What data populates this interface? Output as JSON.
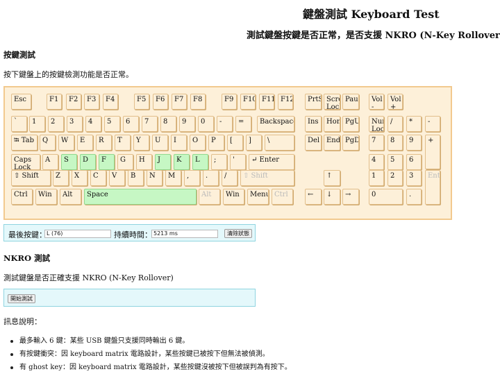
{
  "header": {
    "title": "鍵盤測試 Keyboard Test",
    "subtitle": "測試鍵盤按鍵是否正常，是否支援 NKRO (N-Key Rollover)"
  },
  "key_test": {
    "heading": "按鍵測試",
    "description": "按下鍵盤上的按鍵檢測功能是否正常。"
  },
  "keyboard": {
    "keys": [
      {
        "label": "Esc",
        "state": "normal"
      },
      {
        "label": "F1",
        "state": "normal"
      },
      {
        "label": "F2",
        "state": "normal"
      },
      {
        "label": "F3",
        "state": "normal"
      },
      {
        "label": "F4",
        "state": "normal"
      },
      {
        "label": "F5",
        "state": "normal"
      },
      {
        "label": "F6",
        "state": "normal"
      },
      {
        "label": "F7",
        "state": "normal"
      },
      {
        "label": "F8",
        "state": "normal"
      },
      {
        "label": "F9",
        "state": "normal"
      },
      {
        "label": "F10",
        "state": "normal"
      },
      {
        "label": "F11",
        "state": "normal"
      },
      {
        "label": "F12",
        "state": "normal"
      },
      {
        "label": "PrtSc",
        "state": "normal"
      },
      {
        "label": "Scroll Lock",
        "state": "normal"
      },
      {
        "label": "Pause",
        "state": "normal"
      },
      {
        "label": "Vol -",
        "state": "normal"
      },
      {
        "label": "Vol +",
        "state": "normal"
      },
      {
        "label": "`",
        "state": "normal"
      },
      {
        "label": "1",
        "state": "normal"
      },
      {
        "label": "2",
        "state": "normal"
      },
      {
        "label": "3",
        "state": "normal"
      },
      {
        "label": "4",
        "state": "normal"
      },
      {
        "label": "5",
        "state": "normal"
      },
      {
        "label": "6",
        "state": "normal"
      },
      {
        "label": "7",
        "state": "normal"
      },
      {
        "label": "8",
        "state": "normal"
      },
      {
        "label": "9",
        "state": "normal"
      },
      {
        "label": "0",
        "state": "normal"
      },
      {
        "label": "-",
        "state": "normal"
      },
      {
        "label": "=",
        "state": "normal"
      },
      {
        "label": "Backspace",
        "state": "normal"
      },
      {
        "label": "Ins",
        "state": "normal"
      },
      {
        "label": "Home",
        "state": "normal"
      },
      {
        "label": "PgUp",
        "state": "normal"
      },
      {
        "label": "Num Lock",
        "state": "normal"
      },
      {
        "label": "/",
        "state": "normal"
      },
      {
        "label": "*",
        "state": "normal"
      },
      {
        "label": "-",
        "state": "normal"
      },
      {
        "label": "⭾ Tab",
        "state": "normal"
      },
      {
        "label": "Q",
        "state": "normal"
      },
      {
        "label": "W",
        "state": "normal"
      },
      {
        "label": "E",
        "state": "normal"
      },
      {
        "label": "R",
        "state": "normal"
      },
      {
        "label": "T",
        "state": "normal"
      },
      {
        "label": "Y",
        "state": "normal"
      },
      {
        "label": "U",
        "state": "normal"
      },
      {
        "label": "I",
        "state": "normal"
      },
      {
        "label": "O",
        "state": "normal"
      },
      {
        "label": "P",
        "state": "normal"
      },
      {
        "label": "[",
        "state": "normal"
      },
      {
        "label": "]",
        "state": "normal"
      },
      {
        "label": "\\",
        "state": "normal"
      },
      {
        "label": "Del",
        "state": "normal"
      },
      {
        "label": "End",
        "state": "normal"
      },
      {
        "label": "PgDn",
        "state": "normal"
      },
      {
        "label": "7",
        "state": "normal"
      },
      {
        "label": "8",
        "state": "normal"
      },
      {
        "label": "9",
        "state": "normal"
      },
      {
        "label": "+",
        "state": "normal"
      },
      {
        "label": "Caps Lock",
        "state": "normal"
      },
      {
        "label": "A",
        "state": "normal"
      },
      {
        "label": "S",
        "state": "pressed"
      },
      {
        "label": "D",
        "state": "pressed"
      },
      {
        "label": "F",
        "state": "pressed"
      },
      {
        "label": "G",
        "state": "normal"
      },
      {
        "label": "H",
        "state": "normal"
      },
      {
        "label": "J",
        "state": "pressed"
      },
      {
        "label": "K",
        "state": "pressed"
      },
      {
        "label": "L",
        "state": "pressed"
      },
      {
        "label": ";",
        "state": "normal"
      },
      {
        "label": "'",
        "state": "normal"
      },
      {
        "label": "↵ Enter",
        "state": "normal"
      },
      {
        "label": "4",
        "state": "normal"
      },
      {
        "label": "5",
        "state": "normal"
      },
      {
        "label": "6",
        "state": "normal"
      },
      {
        "label": "⇧ Shift",
        "state": "normal"
      },
      {
        "label": "Z",
        "state": "normal"
      },
      {
        "label": "X",
        "state": "normal"
      },
      {
        "label": "C",
        "state": "normal"
      },
      {
        "label": "V",
        "state": "normal"
      },
      {
        "label": "B",
        "state": "normal"
      },
      {
        "label": "N",
        "state": "normal"
      },
      {
        "label": "M",
        "state": "normal"
      },
      {
        "label": ",",
        "state": "normal"
      },
      {
        "label": ".",
        "state": "normal"
      },
      {
        "label": "/",
        "state": "normal"
      },
      {
        "label": "⇧ Shift",
        "state": "disabled"
      },
      {
        "label": "↑",
        "state": "normal"
      },
      {
        "label": "1",
        "state": "normal"
      },
      {
        "label": "2",
        "state": "normal"
      },
      {
        "label": "3",
        "state": "normal"
      },
      {
        "label": "Enter",
        "state": "disabled"
      },
      {
        "label": "Ctrl",
        "state": "normal"
      },
      {
        "label": "Win",
        "state": "normal"
      },
      {
        "label": "Alt",
        "state": "normal"
      },
      {
        "label": "Space",
        "state": "pressed"
      },
      {
        "label": "Alt",
        "state": "disabled"
      },
      {
        "label": "Win",
        "state": "normal"
      },
      {
        "label": "Menu",
        "state": "normal"
      },
      {
        "label": "Ctrl",
        "state": "disabled"
      },
      {
        "label": "←",
        "state": "normal"
      },
      {
        "label": "↓",
        "state": "normal"
      },
      {
        "label": "→",
        "state": "normal"
      },
      {
        "label": "0",
        "state": "normal"
      },
      {
        "label": ".",
        "state": "normal"
      }
    ]
  },
  "status": {
    "last_key_label": "最後按鍵：",
    "last_key_value": "L (76)",
    "duration_label": "持續時間：",
    "duration_value": "5213 ms",
    "clear_button": "清除狀態"
  },
  "nkro": {
    "heading": "NKRO 測試",
    "description": "測試鍵盤是否正確支援 NKRO (N-Key Rollover)",
    "start_button": "開始測試"
  },
  "info": {
    "heading": "訊息說明：",
    "items": [
      "最多輸入 6 鍵：某些 USB 鍵盤只支援同時輸出 6 鍵。",
      "有按鍵衝突：因 keyboard matrix 電路設計，某些按鍵已被按下但無法被偵測。",
      "有 ghost key：因 keyboard matrix 電路設計，某些按鍵沒被按下但被誤判為有按下。"
    ]
  },
  "colors": {
    "key_bg": "#fdf0d9",
    "key_pressed": "#c6f7c4",
    "keyboard_border": "#f2c98e",
    "panel_bg": "#e4f8fb",
    "panel_border": "#8fd4e0"
  }
}
